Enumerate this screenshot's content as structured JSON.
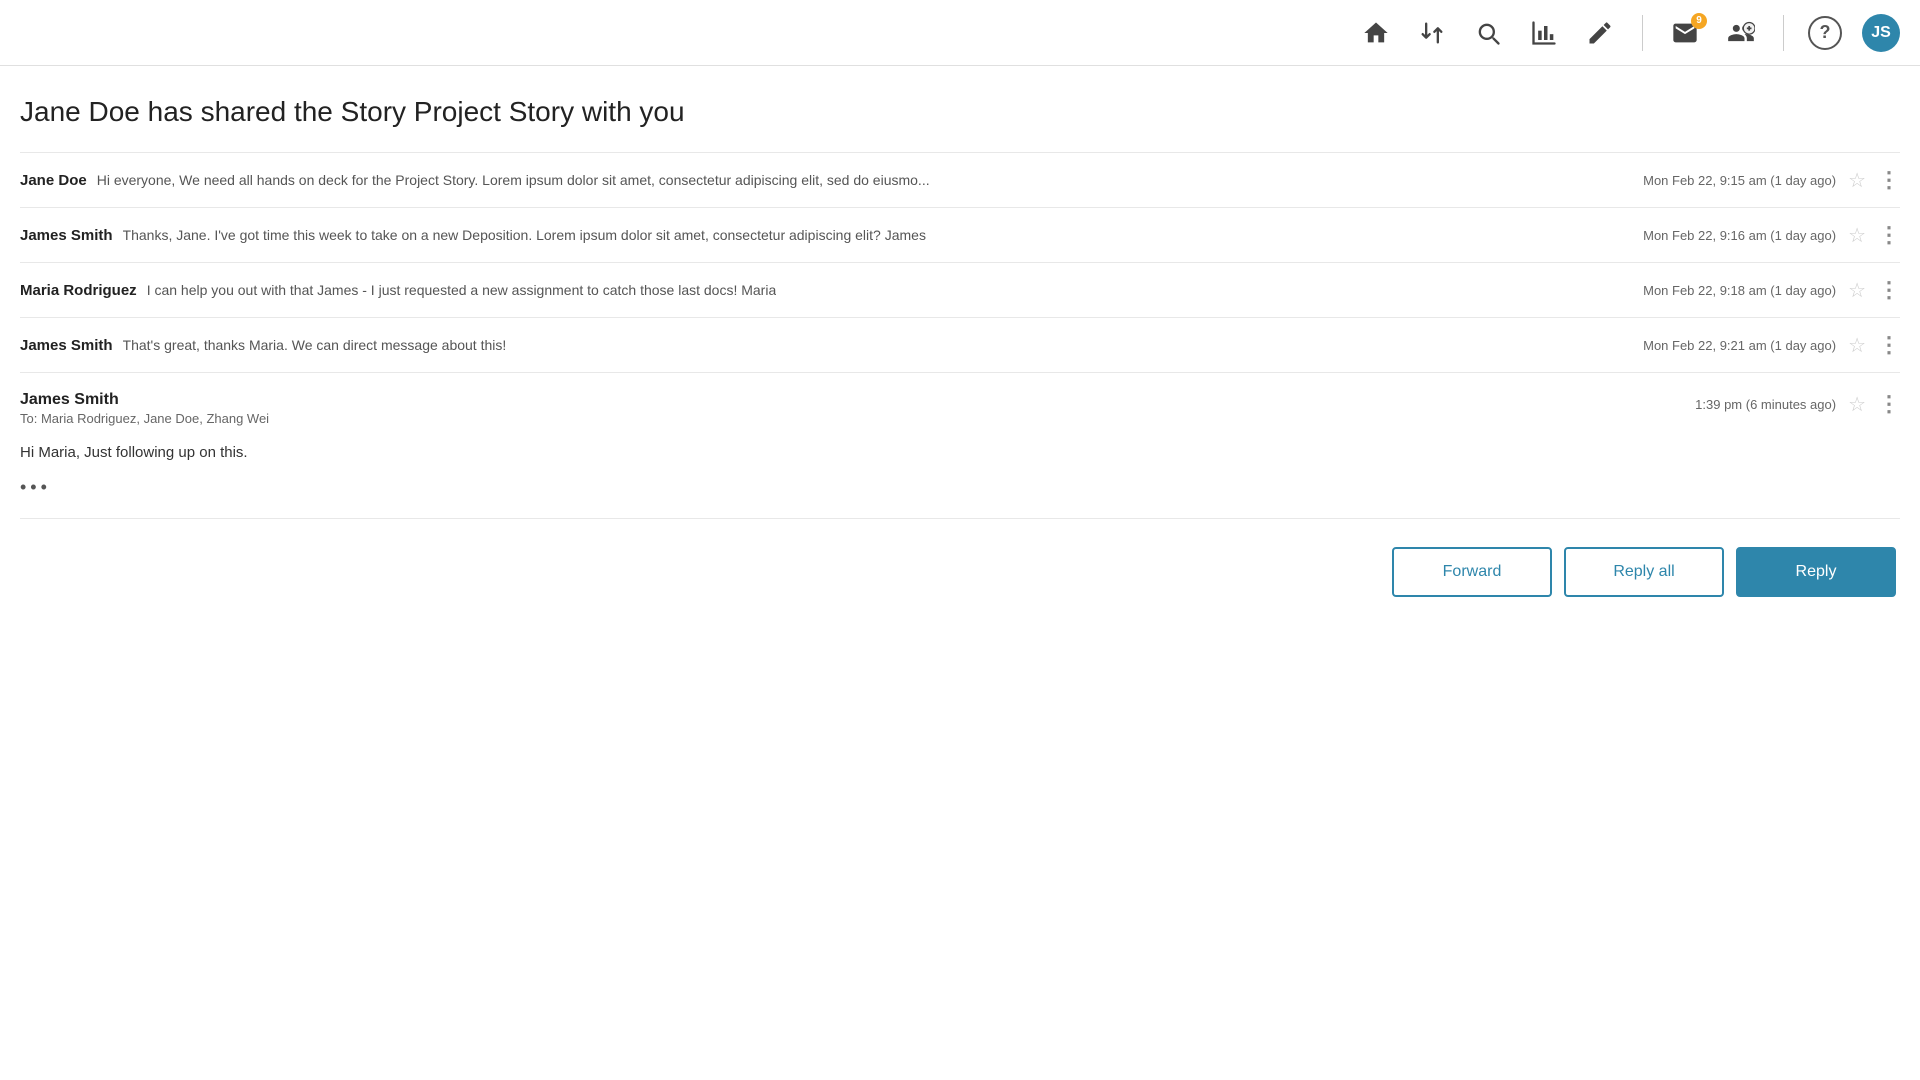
{
  "navbar": {
    "icons": [
      {
        "name": "home-icon",
        "unicode": "⌂",
        "interactable": true
      },
      {
        "name": "sort-icon",
        "unicode": "⇅",
        "interactable": true
      },
      {
        "name": "search-icon",
        "unicode": "🔍",
        "interactable": true
      },
      {
        "name": "chart-icon",
        "unicode": "📊",
        "interactable": true
      },
      {
        "name": "edit-icon",
        "unicode": "✏",
        "interactable": true
      }
    ],
    "mail_badge": "9",
    "help_label": "?",
    "avatar_label": "JS"
  },
  "email": {
    "subject": "Jane Doe has shared the Story Project Story with you",
    "messages": [
      {
        "sender": "Jane Doe",
        "preview": "Hi everyone,  We need all hands on deck for the Project Story. Lorem ipsum dolor sit amet, consectetur adipiscing elit, sed do eiusmo...",
        "time": "Mon Feb 22, 9:15 am (1 day ago)"
      },
      {
        "sender": "James Smith",
        "preview": "Thanks, Jane. I've got time this week to take on a new Deposition. Lorem ipsum dolor sit amet, consectetur adipiscing elit? James",
        "time": "Mon Feb 22, 9:16 am (1 day ago)"
      },
      {
        "sender": "Maria Rodriguez",
        "preview": "I can help you out with that James - I just requested a new assignment to catch those last docs! Maria",
        "time": "Mon Feb 22, 9:18 am (1 day ago)"
      },
      {
        "sender": "James Smith",
        "preview": "That's great, thanks Maria. We can direct message about this!",
        "time": "Mon Feb 22, 9:21 am (1 day ago)"
      }
    ],
    "expanded": {
      "sender": "James Smith",
      "to_label": "To:",
      "to_recipients": "Maria Rodriguez, Jane Doe, Zhang Wei",
      "time": "1:39 pm (6 minutes ago)",
      "body_line1": "Hi Maria, Just following up on this.",
      "dots": "•••"
    },
    "buttons": {
      "forward": "Forward",
      "reply_all": "Reply all",
      "reply": "Reply"
    }
  }
}
